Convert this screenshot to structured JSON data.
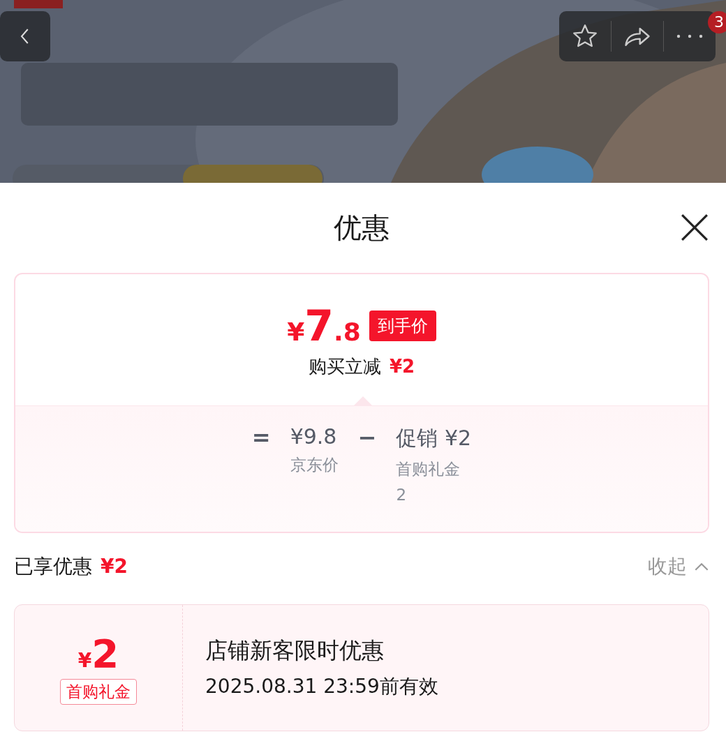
{
  "header": {
    "badge": "3"
  },
  "sheet": {
    "title": "优惠",
    "price": {
      "currency": "¥",
      "integer": "7",
      "decimal": ".8",
      "tag": "到手价"
    },
    "saving": {
      "label": "购买立减",
      "amount": "¥2"
    },
    "breakdown": [
      {
        "kind": "operator",
        "text": "="
      },
      {
        "kind": "term",
        "text": "¥9.8",
        "notes": [
          "京东价"
        ]
      },
      {
        "kind": "operator",
        "text": "−"
      },
      {
        "kind": "term",
        "text": "促销 ¥2",
        "notes": [
          "首购礼金",
          "2"
        ]
      }
    ],
    "enjoyed": {
      "label": "已享优惠",
      "amount": "¥2",
      "toggle": "收起",
      "expanded": true
    },
    "coupons": [
      {
        "currency": "¥",
        "amount": "2",
        "tag": "首购礼金",
        "title": "店铺新客限时优惠",
        "validity": "2025.08.31 23:59前有效"
      }
    ]
  }
}
